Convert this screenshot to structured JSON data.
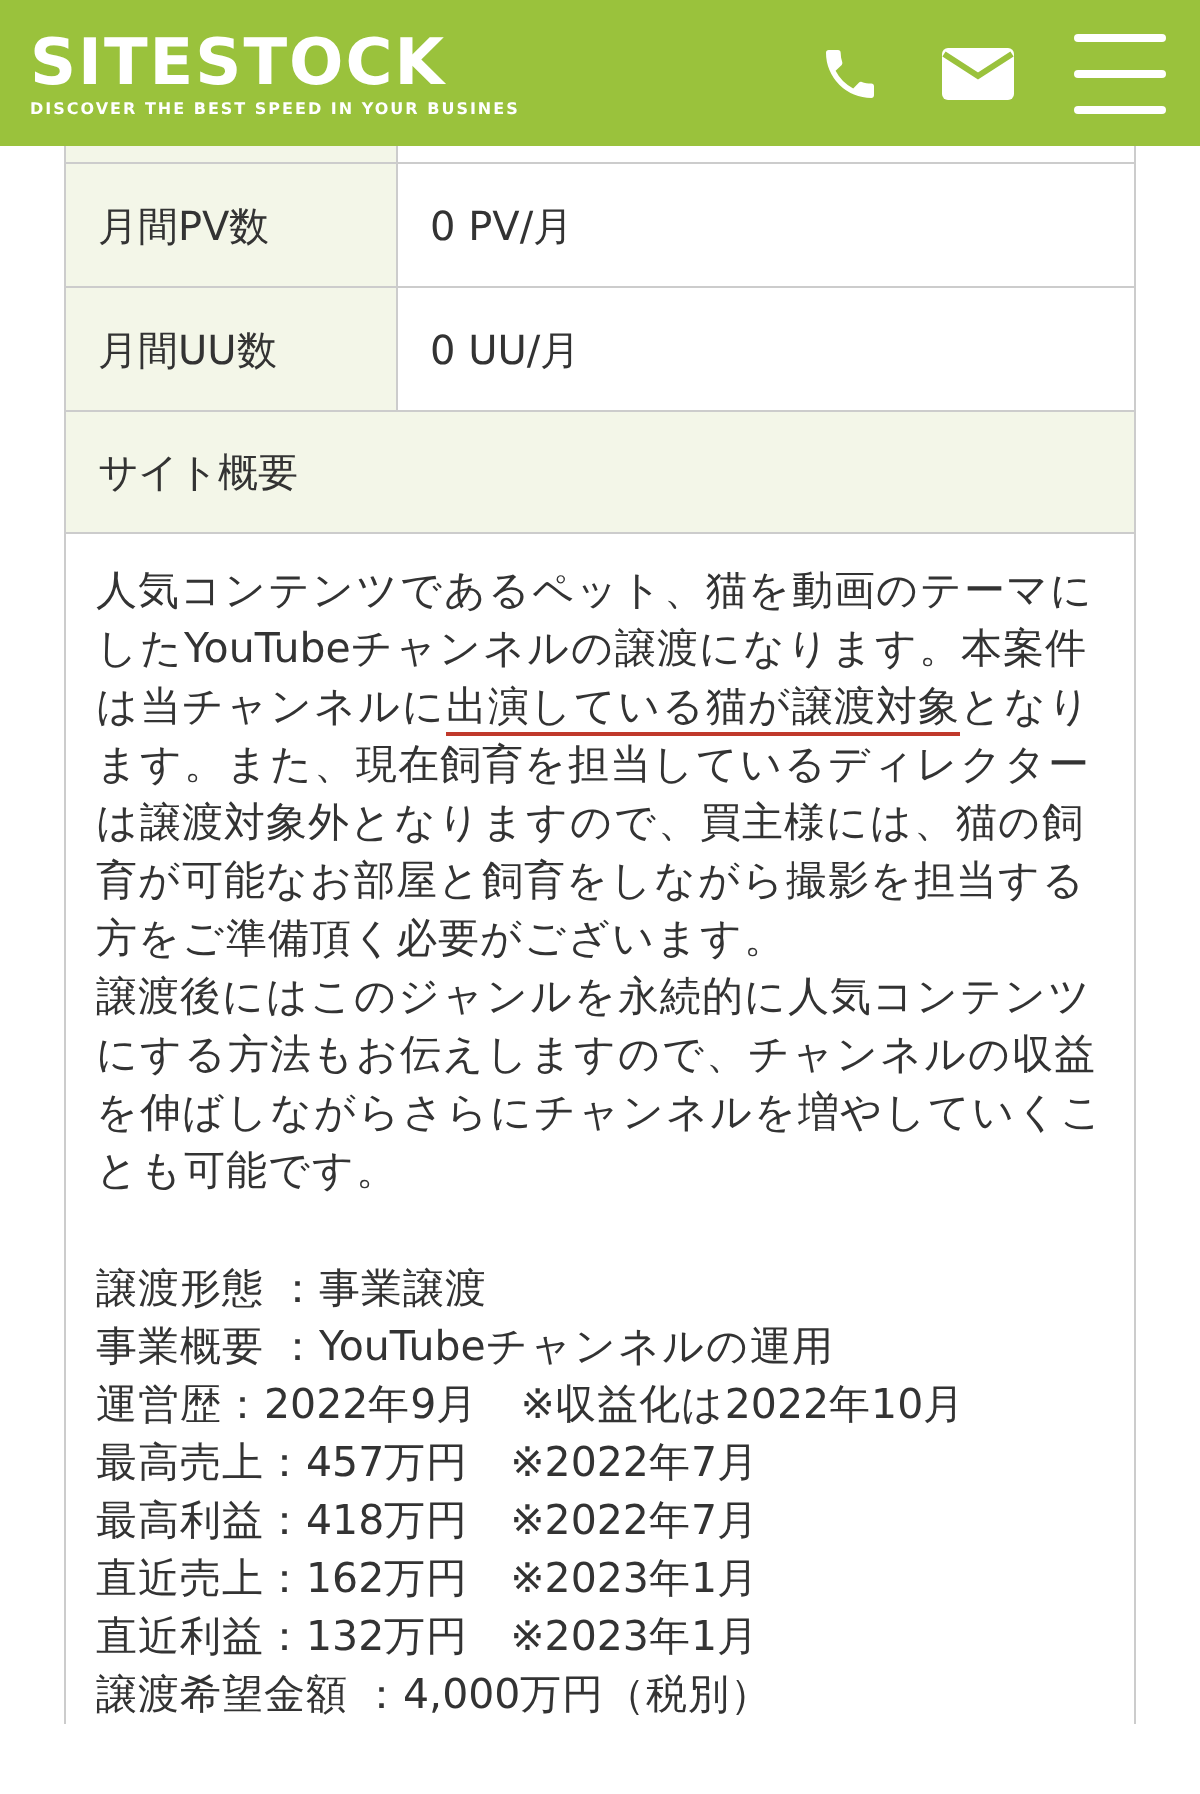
{
  "header": {
    "logo": "SITESTOCK",
    "tagline": "DISCOVER THE BEST SPEED IN YOUR BUSINES"
  },
  "rows": [
    {
      "label": "月間PV数",
      "value": "0 PV/月"
    },
    {
      "label": "月間UU数",
      "value": "0 UU/月"
    }
  ],
  "section": {
    "title": "サイト概要"
  },
  "description": {
    "before": "人気コンテンツであるペット、猫を動画のテーマにしたYouTubeチャンネルの譲渡になります。本案件は当チャンネルに",
    "marked": "出演している猫が譲渡対象",
    "after": "となります。また、現在飼育を担当しているディレクターは譲渡対象外となりますので、買主様には、猫の飼育が可能なお部屋と飼育をしながら撮影を担当する方をご準備頂く必要がございます。"
  },
  "paragraph2": "譲渡後にはこのジャンルを永続的に人気コンテンツにする方法もお伝えしますので、チャンネルの収益を伸ばしながらさらにチャンネルを増やしていくことも可能です。",
  "details": [
    "譲渡形態 ：事業譲渡",
    "事業概要 ：YouTubeチャンネルの運用",
    "運営歴：2022年9月　※収益化は2022年10月",
    "最高売上：457万円　※2022年7月",
    "最高利益：418万円　※2022年7月",
    "直近売上：162万円　※2023年1月",
    "直近利益：132万円　※2023年1月",
    "譲渡希望金額 ：4,000万円（税別）"
  ]
}
